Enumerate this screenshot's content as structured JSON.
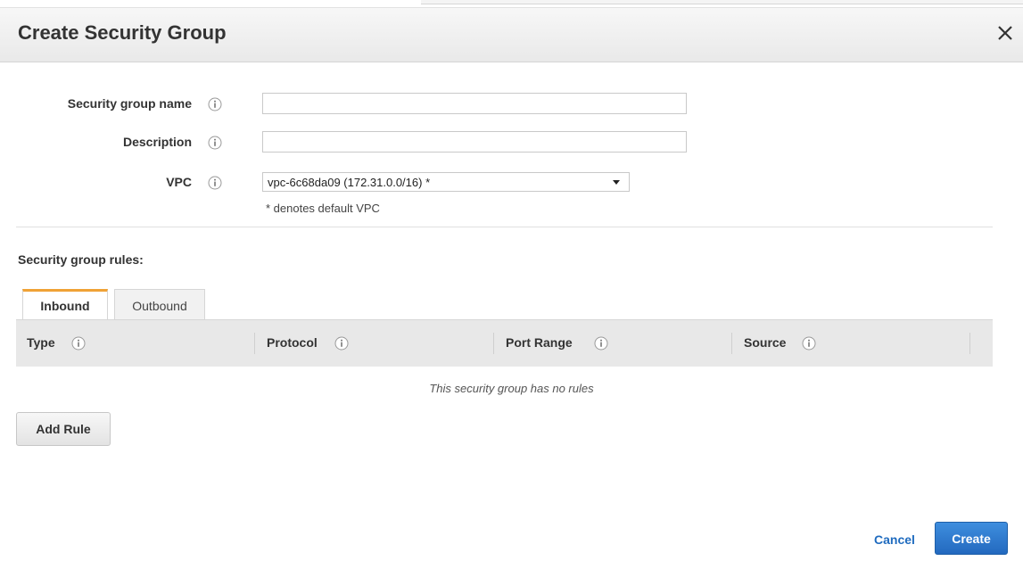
{
  "dialog": {
    "title": "Create Security Group",
    "close_icon": "close-icon"
  },
  "form": {
    "name_label": "Security group name",
    "name_value": "",
    "description_label": "Description",
    "description_value": "",
    "vpc_label": "VPC",
    "vpc_selected": "vpc-6c68da09 (172.31.0.0/16) *",
    "vpc_note": "* denotes default VPC",
    "info_icon": "info-icon"
  },
  "rules": {
    "heading": "Security group rules:",
    "tabs": [
      {
        "label": "Inbound",
        "active": true
      },
      {
        "label": "Outbound",
        "active": false
      }
    ],
    "columns": [
      "Type",
      "Protocol",
      "Port Range",
      "Source"
    ],
    "empty_message": "This security group has no rules",
    "add_rule_label": "Add Rule"
  },
  "footer": {
    "cancel_label": "Cancel",
    "create_label": "Create"
  },
  "colors": {
    "primary_button": "#2369bf",
    "link": "#1f6bbf",
    "active_tab_accent": "#f0a236"
  }
}
